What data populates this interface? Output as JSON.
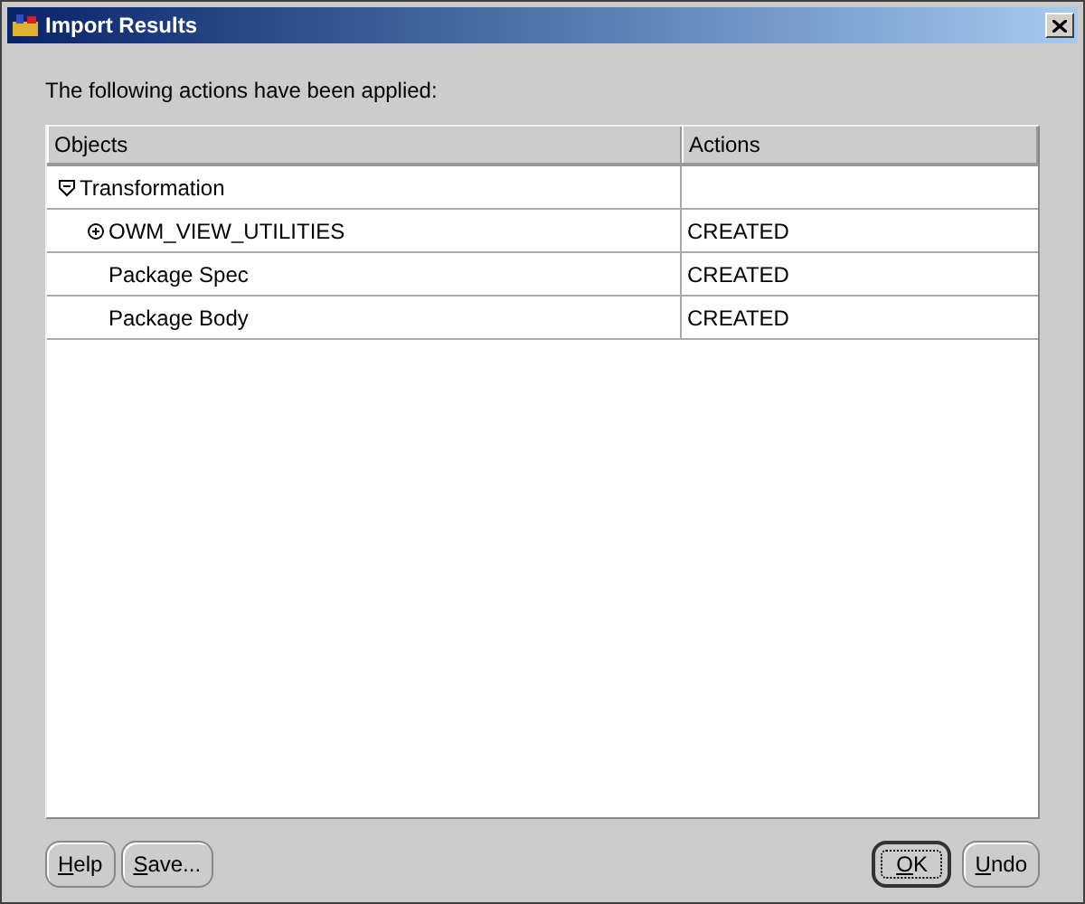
{
  "window": {
    "title": "Import Results"
  },
  "message": "The following actions have been applied:",
  "table": {
    "columns": [
      "Objects",
      "Actions"
    ],
    "rows": [
      {
        "object": "Transformation",
        "action": "",
        "expanded": true,
        "children": [
          {
            "object": "OWM_VIEW_UTILITIES",
            "action": "CREATED",
            "expanded": false
          },
          {
            "object": "Package Spec",
            "action": "CREATED"
          },
          {
            "object": "Package Body",
            "action": "CREATED"
          }
        ]
      }
    ]
  },
  "buttons_left": [
    {
      "label": "Help",
      "default": false
    },
    {
      "label": "Save...",
      "default": false
    }
  ],
  "buttons_right": [
    {
      "label": "OK",
      "default": true
    },
    {
      "label": "Undo",
      "default": false
    }
  ]
}
